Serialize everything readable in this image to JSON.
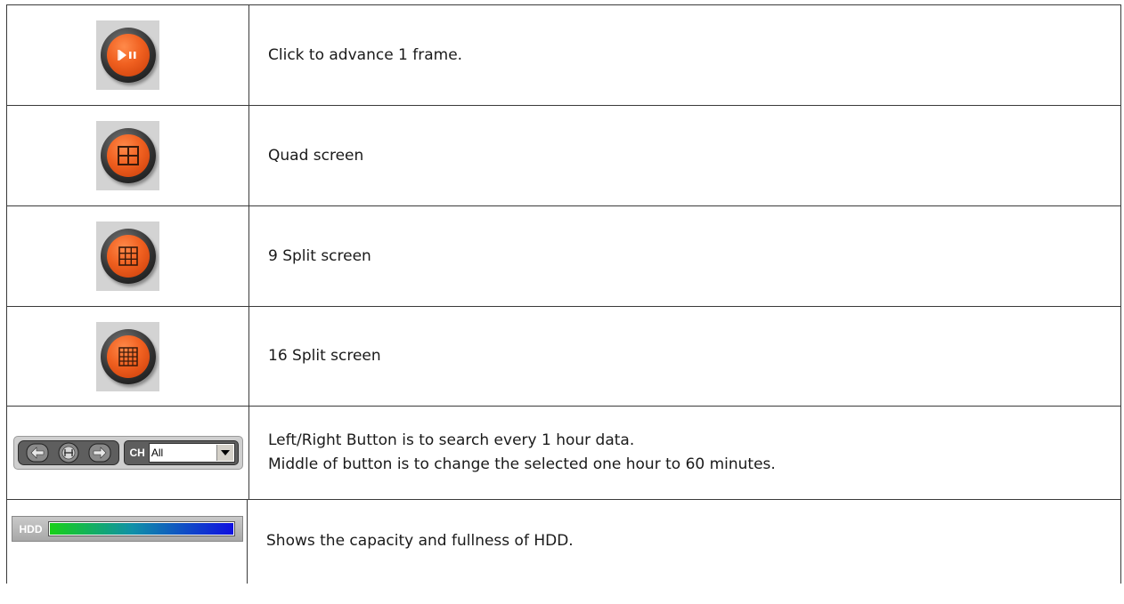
{
  "rows": [
    {
      "icon": "frame-advance-icon",
      "text": "Click to advance 1 frame."
    },
    {
      "icon": "quad-screen-icon",
      "text": "Quad screen"
    },
    {
      "icon": "nine-split-screen-icon",
      "text": "9 Split screen"
    },
    {
      "icon": "sixteen-split-screen-icon",
      "text": "16 Split screen"
    },
    {
      "icon": "hour-search-control",
      "text_line1": "Left/Right Button is to search every 1 hour data.",
      "text_line2": "Middle of button is to change the selected one hour to 60 minutes.",
      "ch_label": "CH",
      "ch_value": "All"
    },
    {
      "icon": "hdd-capacity-bar",
      "text": "Shows the capacity and fullness of HDD.",
      "hdd_label": "HDD",
      "hdd_fill_percent": 100
    }
  ],
  "colors": {
    "button_orange": "#f06020",
    "tile_gray": "#d3d3d3",
    "border": "#3a3a3a"
  }
}
